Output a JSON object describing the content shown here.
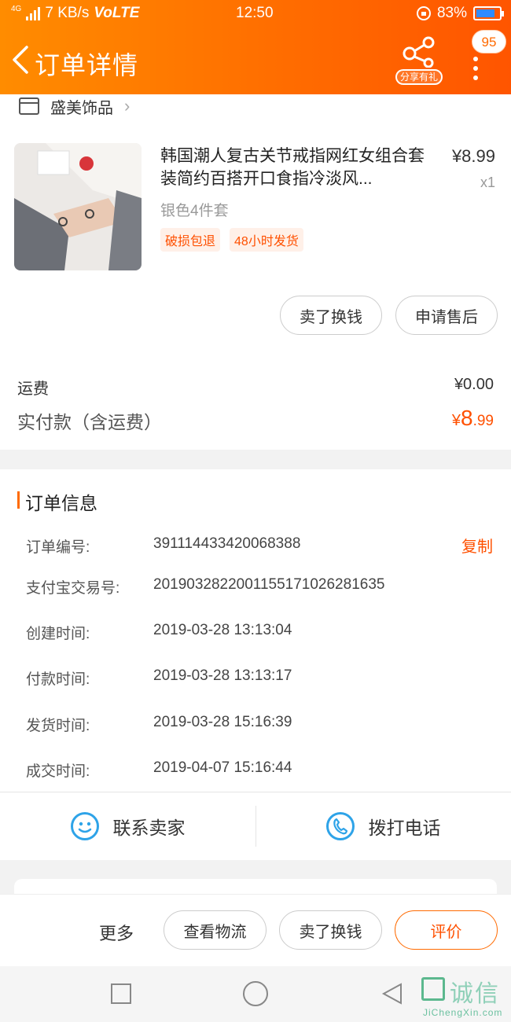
{
  "status_bar": {
    "network": "4G",
    "speed": "7 KB/s",
    "volte": "VoLTE",
    "time": "12:50",
    "battery": "83%",
    "battery_level": 0.83
  },
  "header": {
    "title": "订单详情",
    "share_label": "分享有礼",
    "message_count": "95"
  },
  "shop": {
    "name": "盛美饰品"
  },
  "product": {
    "title": "韩国潮人复古关节戒指网红女组合套装简约百搭开口食指冷淡风...",
    "price": "¥8.99",
    "quantity": "x1",
    "sku": "银色4件套",
    "tags": [
      "破损包退",
      "48小时发货"
    ]
  },
  "item_actions": {
    "sell": "卖了换钱",
    "after_sale": "申请售后"
  },
  "payment": {
    "freight_label": "运费",
    "freight_value": "¥0.00",
    "paid_label": "实付款（含运费）",
    "paid_currency": "¥",
    "paid_int": "8",
    "paid_dec": ".99"
  },
  "order_info": {
    "title": "订单信息",
    "copy_label": "复制",
    "rows": [
      {
        "label": "订单编号:",
        "value": "391114433420068388"
      },
      {
        "label": "支付宝交易号:",
        "value": "2019032822001155171026281635"
      },
      {
        "label": "创建时间:",
        "value": "2019-03-28 13:13:04"
      },
      {
        "label": "付款时间:",
        "value": "2019-03-28 13:13:17"
      },
      {
        "label": "发货时间:",
        "value": "2019-03-28 15:16:39"
      },
      {
        "label": "成交时间:",
        "value": "2019-04-07 15:16:44"
      }
    ]
  },
  "contact": {
    "seller": "联系卖家",
    "phone": "拨打电话"
  },
  "bottom_bar": {
    "more": "更多",
    "logistics": "查看物流",
    "sell": "卖了换钱",
    "review": "评价"
  },
  "watermark": {
    "text": "诚信",
    "url": "JiChengXin.com"
  },
  "colors": {
    "accent": "#ff6a00",
    "price_red": "#ff5000",
    "icon_blue": "#2ea3e8"
  }
}
